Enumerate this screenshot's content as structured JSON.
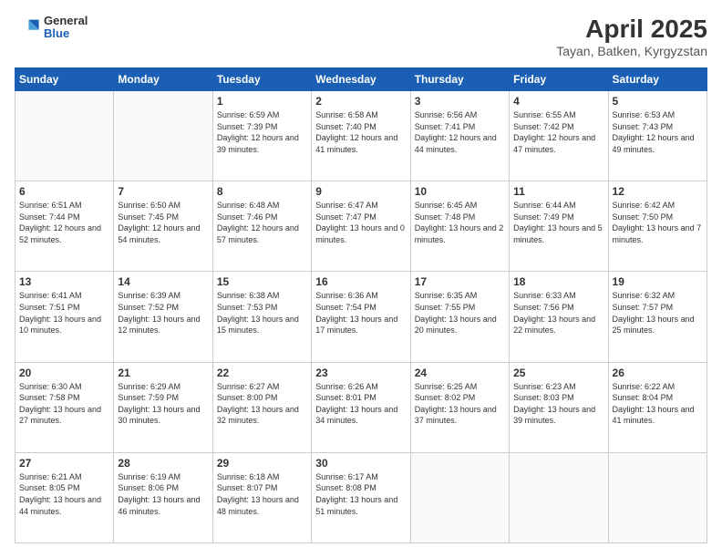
{
  "header": {
    "logo": {
      "general": "General",
      "blue": "Blue"
    },
    "title": "April 2025",
    "location": "Tayan, Batken, Kyrgyzstan"
  },
  "calendar": {
    "days_of_week": [
      "Sunday",
      "Monday",
      "Tuesday",
      "Wednesday",
      "Thursday",
      "Friday",
      "Saturday"
    ],
    "weeks": [
      [
        {
          "day": "",
          "info": ""
        },
        {
          "day": "",
          "info": ""
        },
        {
          "day": "1",
          "info": "Sunrise: 6:59 AM\nSunset: 7:39 PM\nDaylight: 12 hours and 39 minutes."
        },
        {
          "day": "2",
          "info": "Sunrise: 6:58 AM\nSunset: 7:40 PM\nDaylight: 12 hours and 41 minutes."
        },
        {
          "day": "3",
          "info": "Sunrise: 6:56 AM\nSunset: 7:41 PM\nDaylight: 12 hours and 44 minutes."
        },
        {
          "day": "4",
          "info": "Sunrise: 6:55 AM\nSunset: 7:42 PM\nDaylight: 12 hours and 47 minutes."
        },
        {
          "day": "5",
          "info": "Sunrise: 6:53 AM\nSunset: 7:43 PM\nDaylight: 12 hours and 49 minutes."
        }
      ],
      [
        {
          "day": "6",
          "info": "Sunrise: 6:51 AM\nSunset: 7:44 PM\nDaylight: 12 hours and 52 minutes."
        },
        {
          "day": "7",
          "info": "Sunrise: 6:50 AM\nSunset: 7:45 PM\nDaylight: 12 hours and 54 minutes."
        },
        {
          "day": "8",
          "info": "Sunrise: 6:48 AM\nSunset: 7:46 PM\nDaylight: 12 hours and 57 minutes."
        },
        {
          "day": "9",
          "info": "Sunrise: 6:47 AM\nSunset: 7:47 PM\nDaylight: 13 hours and 0 minutes."
        },
        {
          "day": "10",
          "info": "Sunrise: 6:45 AM\nSunset: 7:48 PM\nDaylight: 13 hours and 2 minutes."
        },
        {
          "day": "11",
          "info": "Sunrise: 6:44 AM\nSunset: 7:49 PM\nDaylight: 13 hours and 5 minutes."
        },
        {
          "day": "12",
          "info": "Sunrise: 6:42 AM\nSunset: 7:50 PM\nDaylight: 13 hours and 7 minutes."
        }
      ],
      [
        {
          "day": "13",
          "info": "Sunrise: 6:41 AM\nSunset: 7:51 PM\nDaylight: 13 hours and 10 minutes."
        },
        {
          "day": "14",
          "info": "Sunrise: 6:39 AM\nSunset: 7:52 PM\nDaylight: 13 hours and 12 minutes."
        },
        {
          "day": "15",
          "info": "Sunrise: 6:38 AM\nSunset: 7:53 PM\nDaylight: 13 hours and 15 minutes."
        },
        {
          "day": "16",
          "info": "Sunrise: 6:36 AM\nSunset: 7:54 PM\nDaylight: 13 hours and 17 minutes."
        },
        {
          "day": "17",
          "info": "Sunrise: 6:35 AM\nSunset: 7:55 PM\nDaylight: 13 hours and 20 minutes."
        },
        {
          "day": "18",
          "info": "Sunrise: 6:33 AM\nSunset: 7:56 PM\nDaylight: 13 hours and 22 minutes."
        },
        {
          "day": "19",
          "info": "Sunrise: 6:32 AM\nSunset: 7:57 PM\nDaylight: 13 hours and 25 minutes."
        }
      ],
      [
        {
          "day": "20",
          "info": "Sunrise: 6:30 AM\nSunset: 7:58 PM\nDaylight: 13 hours and 27 minutes."
        },
        {
          "day": "21",
          "info": "Sunrise: 6:29 AM\nSunset: 7:59 PM\nDaylight: 13 hours and 30 minutes."
        },
        {
          "day": "22",
          "info": "Sunrise: 6:27 AM\nSunset: 8:00 PM\nDaylight: 13 hours and 32 minutes."
        },
        {
          "day": "23",
          "info": "Sunrise: 6:26 AM\nSunset: 8:01 PM\nDaylight: 13 hours and 34 minutes."
        },
        {
          "day": "24",
          "info": "Sunrise: 6:25 AM\nSunset: 8:02 PM\nDaylight: 13 hours and 37 minutes."
        },
        {
          "day": "25",
          "info": "Sunrise: 6:23 AM\nSunset: 8:03 PM\nDaylight: 13 hours and 39 minutes."
        },
        {
          "day": "26",
          "info": "Sunrise: 6:22 AM\nSunset: 8:04 PM\nDaylight: 13 hours and 41 minutes."
        }
      ],
      [
        {
          "day": "27",
          "info": "Sunrise: 6:21 AM\nSunset: 8:05 PM\nDaylight: 13 hours and 44 minutes."
        },
        {
          "day": "28",
          "info": "Sunrise: 6:19 AM\nSunset: 8:06 PM\nDaylight: 13 hours and 46 minutes."
        },
        {
          "day": "29",
          "info": "Sunrise: 6:18 AM\nSunset: 8:07 PM\nDaylight: 13 hours and 48 minutes."
        },
        {
          "day": "30",
          "info": "Sunrise: 6:17 AM\nSunset: 8:08 PM\nDaylight: 13 hours and 51 minutes."
        },
        {
          "day": "",
          "info": ""
        },
        {
          "day": "",
          "info": ""
        },
        {
          "day": "",
          "info": ""
        }
      ]
    ]
  }
}
